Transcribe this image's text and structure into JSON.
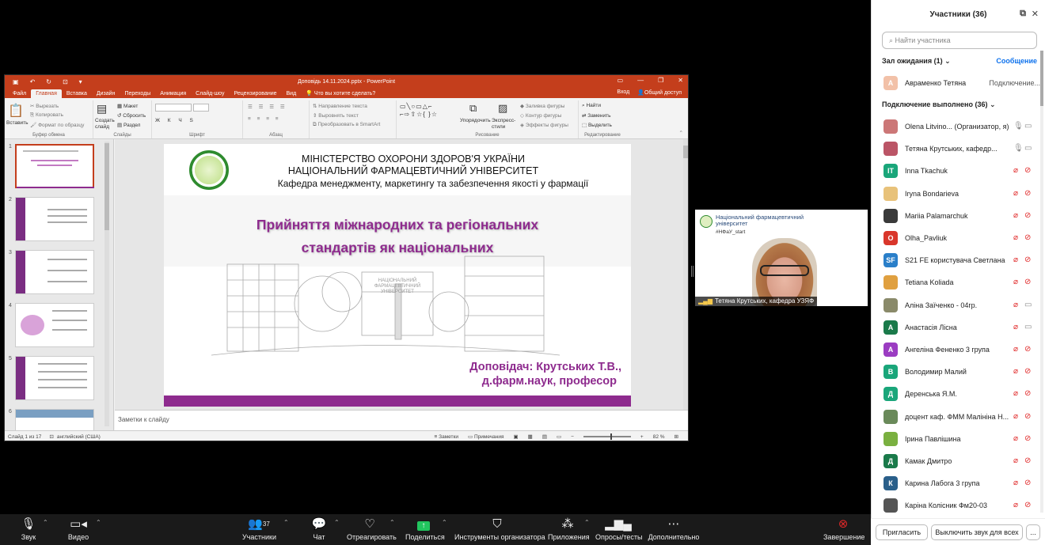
{
  "ppt": {
    "title": "Доповідь 14.11.2024.pptx - PowerPoint",
    "menu": [
      "Файл",
      "Главная",
      "Вставка",
      "Дизайн",
      "Переходы",
      "Анимация",
      "Слайд-шоу",
      "Рецензирование",
      "Вид"
    ],
    "tell_me": "Что вы хотите сделать?",
    "login": "Вход",
    "share": "Общий доступ",
    "ribbon": {
      "paste": "Вставить",
      "cut": "Вырезать",
      "copy": "Копировать",
      "format_painter": "Формат по образцу",
      "clipboard_group": "Буфер обмена",
      "new_slide": "Создать слайд",
      "layout": "Макет",
      "reset": "Сбросить",
      "section": "Раздел",
      "slides_group": "Слайды",
      "font_group": "Шрифт",
      "paragraph_group": "Абзац",
      "text_direction": "Направление текста",
      "align_text": "Выровнять текст",
      "smartart": "Преобразовать в SmartArt",
      "arrange": "Упорядочить",
      "quick_styles": "Экспресс-стили",
      "shape_fill": "Заливка фигуры",
      "shape_outline": "Контур фигуры",
      "shape_effects": "Эффекты фигуры",
      "drawing_group": "Рисование",
      "find": "Найти",
      "replace": "Заменить",
      "select": "Выделить",
      "editing_group": "Редактирование"
    },
    "thumb_numbers": [
      "1",
      "2",
      "3",
      "4",
      "5",
      "6"
    ],
    "slide": {
      "line1": "МІНІСТЕРСТВО ОХОРОНИ ЗДОРОВ'Я УКРАЇНИ",
      "line2": "НАЦІОНАЛЬНИЙ ФАРМАЦЕВТИЧНИЙ УНІВЕРСИТЕТ",
      "line3": "Кафедра менеджменту, маркетингу та забезпечення якості у фармації",
      "title1": "Прийняття міжнародних та регіональних",
      "title2": "стандартів як національних",
      "speaker1": "Доповідач: Крутських Т.В.,",
      "speaker2": "д.фарм.наук, професор"
    },
    "notes": "Заметки к слайду",
    "status": {
      "slide": "Слайд 1 из 17",
      "lang": "английский (США)",
      "notes": "Заметки",
      "comments": "Примечания",
      "zoom": "82 %"
    }
  },
  "video": {
    "org_line": "Національний фармацевтичний університет",
    "hashtag": "#НФаУ_start",
    "name": "Тетяна Крутських, кафедра УЗЯФ"
  },
  "panel": {
    "title": "Участники (36)",
    "search_placeholder": "Найти участника",
    "waiting": "Зал ожидания (1)",
    "message": "Сообщение",
    "waiting_user": "Авраменко Тетяна",
    "waiting_status": "Подключение...",
    "connected": "Подключение выполнено (36)",
    "participants": [
      {
        "initial": "",
        "name": "Olena Litvino... (Организатор, я)",
        "color": "#c77",
        "mic": "on",
        "cam": "on"
      },
      {
        "initial": "",
        "name": "Тетяна Крутських, кафедр...",
        "color": "#b56",
        "mic": "on",
        "cam": "on"
      },
      {
        "initial": "IT",
        "name": "Inna Tkachuk",
        "color": "#1aa67a",
        "mic": "off",
        "cam": "off"
      },
      {
        "initial": "",
        "name": "Iryna Bondarieva",
        "color": "#e8c27a",
        "mic": "off",
        "cam": "off"
      },
      {
        "initial": "",
        "name": "Mariia Palamarchuk",
        "color": "#3a3a3a",
        "mic": "off",
        "cam": "off"
      },
      {
        "initial": "O",
        "name": "Olha_Pavliuk",
        "color": "#d9362b",
        "mic": "off",
        "cam": "off"
      },
      {
        "initial": "SF",
        "name": "S21 FE користувача Светлана",
        "color": "#2a7fc9",
        "mic": "off",
        "cam": "off"
      },
      {
        "initial": "",
        "name": "Tetiana Koliada",
        "color": "#e0a040",
        "mic": "off",
        "cam": "off"
      },
      {
        "initial": "",
        "name": "Аліна Заїченко - 04гр.",
        "color": "#8a8a6a",
        "mic": "off",
        "cam": "on"
      },
      {
        "initial": "А",
        "name": "Анастасія Лісна",
        "color": "#1a7a4a",
        "mic": "off",
        "cam": "on"
      },
      {
        "initial": "А",
        "name": "Ангеліна Фененко 3 група",
        "color": "#9b3cc2",
        "mic": "off",
        "cam": "off"
      },
      {
        "initial": "В",
        "name": "Володимир Малий",
        "color": "#1aa67a",
        "mic": "off",
        "cam": "off"
      },
      {
        "initial": "Д",
        "name": "Деренська Я.М.",
        "color": "#1aa67a",
        "mic": "off",
        "cam": "off"
      },
      {
        "initial": "",
        "name": "доцент каф. ФММ Малініна Н...",
        "color": "#6a8a5a",
        "mic": "off",
        "cam": "off"
      },
      {
        "initial": "",
        "name": "Ірина Павлішина",
        "color": "#7ab040",
        "mic": "off",
        "cam": "off"
      },
      {
        "initial": "Д",
        "name": "Камак Дмитро",
        "color": "#1a7a4a",
        "mic": "off",
        "cam": "off"
      },
      {
        "initial": "К",
        "name": "Карина Лабога 3 група",
        "color": "#2a5f8a",
        "mic": "off",
        "cam": "off"
      },
      {
        "initial": "",
        "name": "Каріна Колісник Фм20-03",
        "color": "#555",
        "mic": "off",
        "cam": "off"
      }
    ],
    "invite": "Пригласить",
    "mute_all": "Выключить звук для всех",
    "more": "..."
  },
  "toolbar": {
    "audio": "Звук",
    "video": "Видео",
    "participants": "Участники",
    "participants_count": "37",
    "chat": "Чат",
    "react": "Отреагировать",
    "share": "Поделиться",
    "host_tools": "Инструменты организатора",
    "apps": "Приложения",
    "polls": "Опросы/тесты",
    "more": "Дополнительно",
    "end": "Завершение"
  }
}
